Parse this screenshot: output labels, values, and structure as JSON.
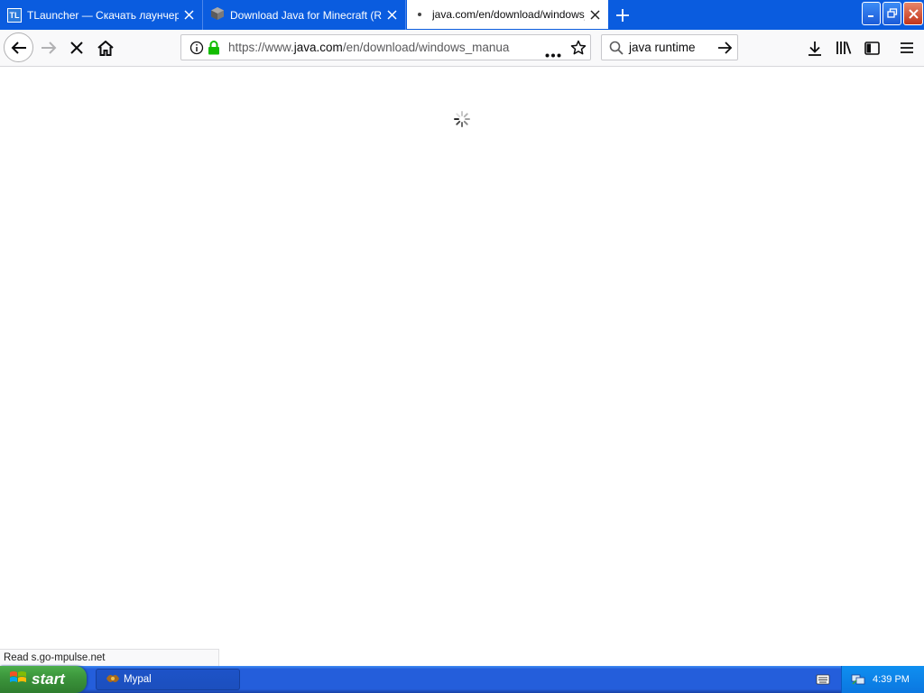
{
  "tabs": [
    {
      "title": "TLauncher — Скачать лаунчер Ми",
      "icon": "tlauncher-icon",
      "icon_text": "TL",
      "active": false
    },
    {
      "title": "Download Java for Minecraft (Rec",
      "icon": "minecraft-block-icon",
      "active": false
    },
    {
      "title": "java.com/en/download/windows_m",
      "icon": "loading-dot-icon",
      "active": true
    }
  ],
  "toolbar": {
    "url_scheme": "https://www.",
    "url_host": "java.com",
    "url_path": "/en/download/windows_manual",
    "search_query": "java runtime"
  },
  "status": {
    "text": "Read s.go-mpulse.net"
  },
  "taskbar": {
    "start_label": "start",
    "task_label": "Mypal",
    "clock": "4:39 PM"
  },
  "colors": {
    "tabstrip": "#0a5cdf",
    "taskbar": "#245edb",
    "start": "#3c963c",
    "lock": "#12bc00"
  }
}
